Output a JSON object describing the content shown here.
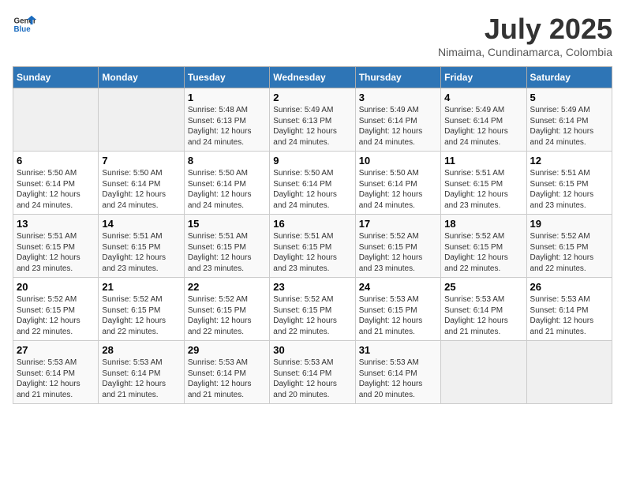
{
  "header": {
    "logo_general": "General",
    "logo_blue": "Blue",
    "title": "July 2025",
    "subtitle": "Nimaima, Cundinamarca, Colombia"
  },
  "weekdays": [
    "Sunday",
    "Monday",
    "Tuesday",
    "Wednesday",
    "Thursday",
    "Friday",
    "Saturday"
  ],
  "weeks": [
    [
      {
        "day": "",
        "empty": true
      },
      {
        "day": "",
        "empty": true
      },
      {
        "day": "1",
        "sunrise": "Sunrise: 5:48 AM",
        "sunset": "Sunset: 6:13 PM",
        "daylight": "Daylight: 12 hours and 24 minutes."
      },
      {
        "day": "2",
        "sunrise": "Sunrise: 5:49 AM",
        "sunset": "Sunset: 6:13 PM",
        "daylight": "Daylight: 12 hours and 24 minutes."
      },
      {
        "day": "3",
        "sunrise": "Sunrise: 5:49 AM",
        "sunset": "Sunset: 6:14 PM",
        "daylight": "Daylight: 12 hours and 24 minutes."
      },
      {
        "day": "4",
        "sunrise": "Sunrise: 5:49 AM",
        "sunset": "Sunset: 6:14 PM",
        "daylight": "Daylight: 12 hours and 24 minutes."
      },
      {
        "day": "5",
        "sunrise": "Sunrise: 5:49 AM",
        "sunset": "Sunset: 6:14 PM",
        "daylight": "Daylight: 12 hours and 24 minutes."
      }
    ],
    [
      {
        "day": "6",
        "sunrise": "Sunrise: 5:50 AM",
        "sunset": "Sunset: 6:14 PM",
        "daylight": "Daylight: 12 hours and 24 minutes."
      },
      {
        "day": "7",
        "sunrise": "Sunrise: 5:50 AM",
        "sunset": "Sunset: 6:14 PM",
        "daylight": "Daylight: 12 hours and 24 minutes."
      },
      {
        "day": "8",
        "sunrise": "Sunrise: 5:50 AM",
        "sunset": "Sunset: 6:14 PM",
        "daylight": "Daylight: 12 hours and 24 minutes."
      },
      {
        "day": "9",
        "sunrise": "Sunrise: 5:50 AM",
        "sunset": "Sunset: 6:14 PM",
        "daylight": "Daylight: 12 hours and 24 minutes."
      },
      {
        "day": "10",
        "sunrise": "Sunrise: 5:50 AM",
        "sunset": "Sunset: 6:14 PM",
        "daylight": "Daylight: 12 hours and 24 minutes."
      },
      {
        "day": "11",
        "sunrise": "Sunrise: 5:51 AM",
        "sunset": "Sunset: 6:15 PM",
        "daylight": "Daylight: 12 hours and 23 minutes."
      },
      {
        "day": "12",
        "sunrise": "Sunrise: 5:51 AM",
        "sunset": "Sunset: 6:15 PM",
        "daylight": "Daylight: 12 hours and 23 minutes."
      }
    ],
    [
      {
        "day": "13",
        "sunrise": "Sunrise: 5:51 AM",
        "sunset": "Sunset: 6:15 PM",
        "daylight": "Daylight: 12 hours and 23 minutes."
      },
      {
        "day": "14",
        "sunrise": "Sunrise: 5:51 AM",
        "sunset": "Sunset: 6:15 PM",
        "daylight": "Daylight: 12 hours and 23 minutes."
      },
      {
        "day": "15",
        "sunrise": "Sunrise: 5:51 AM",
        "sunset": "Sunset: 6:15 PM",
        "daylight": "Daylight: 12 hours and 23 minutes."
      },
      {
        "day": "16",
        "sunrise": "Sunrise: 5:51 AM",
        "sunset": "Sunset: 6:15 PM",
        "daylight": "Daylight: 12 hours and 23 minutes."
      },
      {
        "day": "17",
        "sunrise": "Sunrise: 5:52 AM",
        "sunset": "Sunset: 6:15 PM",
        "daylight": "Daylight: 12 hours and 23 minutes."
      },
      {
        "day": "18",
        "sunrise": "Sunrise: 5:52 AM",
        "sunset": "Sunset: 6:15 PM",
        "daylight": "Daylight: 12 hours and 22 minutes."
      },
      {
        "day": "19",
        "sunrise": "Sunrise: 5:52 AM",
        "sunset": "Sunset: 6:15 PM",
        "daylight": "Daylight: 12 hours and 22 minutes."
      }
    ],
    [
      {
        "day": "20",
        "sunrise": "Sunrise: 5:52 AM",
        "sunset": "Sunset: 6:15 PM",
        "daylight": "Daylight: 12 hours and 22 minutes."
      },
      {
        "day": "21",
        "sunrise": "Sunrise: 5:52 AM",
        "sunset": "Sunset: 6:15 PM",
        "daylight": "Daylight: 12 hours and 22 minutes."
      },
      {
        "day": "22",
        "sunrise": "Sunrise: 5:52 AM",
        "sunset": "Sunset: 6:15 PM",
        "daylight": "Daylight: 12 hours and 22 minutes."
      },
      {
        "day": "23",
        "sunrise": "Sunrise: 5:52 AM",
        "sunset": "Sunset: 6:15 PM",
        "daylight": "Daylight: 12 hours and 22 minutes."
      },
      {
        "day": "24",
        "sunrise": "Sunrise: 5:53 AM",
        "sunset": "Sunset: 6:15 PM",
        "daylight": "Daylight: 12 hours and 21 minutes."
      },
      {
        "day": "25",
        "sunrise": "Sunrise: 5:53 AM",
        "sunset": "Sunset: 6:14 PM",
        "daylight": "Daylight: 12 hours and 21 minutes."
      },
      {
        "day": "26",
        "sunrise": "Sunrise: 5:53 AM",
        "sunset": "Sunset: 6:14 PM",
        "daylight": "Daylight: 12 hours and 21 minutes."
      }
    ],
    [
      {
        "day": "27",
        "sunrise": "Sunrise: 5:53 AM",
        "sunset": "Sunset: 6:14 PM",
        "daylight": "Daylight: 12 hours and 21 minutes."
      },
      {
        "day": "28",
        "sunrise": "Sunrise: 5:53 AM",
        "sunset": "Sunset: 6:14 PM",
        "daylight": "Daylight: 12 hours and 21 minutes."
      },
      {
        "day": "29",
        "sunrise": "Sunrise: 5:53 AM",
        "sunset": "Sunset: 6:14 PM",
        "daylight": "Daylight: 12 hours and 21 minutes."
      },
      {
        "day": "30",
        "sunrise": "Sunrise: 5:53 AM",
        "sunset": "Sunset: 6:14 PM",
        "daylight": "Daylight: 12 hours and 20 minutes."
      },
      {
        "day": "31",
        "sunrise": "Sunrise: 5:53 AM",
        "sunset": "Sunset: 6:14 PM",
        "daylight": "Daylight: 12 hours and 20 minutes."
      },
      {
        "day": "",
        "empty": true
      },
      {
        "day": "",
        "empty": true
      }
    ]
  ]
}
